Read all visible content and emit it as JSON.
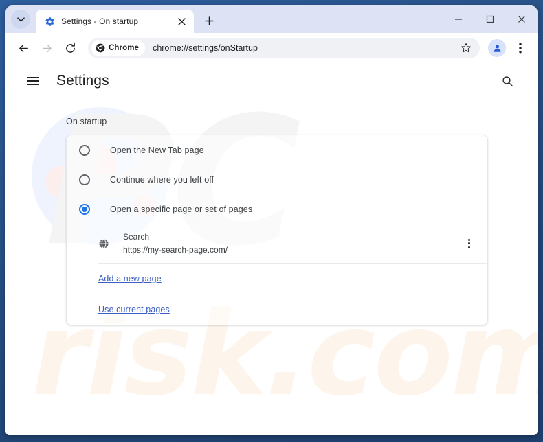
{
  "browser": {
    "tab": {
      "title": "Settings - On startup",
      "favicon": "gear-icon",
      "close": "✕"
    },
    "new_tab_label": "+",
    "window_controls": {
      "minimize": "─",
      "maximize": "□",
      "close": "✕"
    },
    "toolbar": {
      "back": "←",
      "forward": "→",
      "reload": "⟳",
      "chrome_chip_label": "Chrome",
      "url": "chrome://settings/onStartup",
      "bookmark": "☆",
      "profile": "profile-avatar",
      "menu": "⋮"
    }
  },
  "settings": {
    "title": "Settings",
    "menu_icon": "hamburger-icon",
    "search_icon": "search-icon",
    "section_title": "On startup",
    "options": [
      {
        "label": "Open the New Tab page",
        "checked": false
      },
      {
        "label": "Continue where you left off",
        "checked": false
      },
      {
        "label": "Open a specific page or set of pages",
        "checked": true
      }
    ],
    "startup_pages": [
      {
        "name": "Search",
        "url": "https://my-search-page.com/",
        "icon": "globe-icon",
        "menu": "kebab-menu-icon"
      }
    ],
    "links": {
      "add_page": "Add a new page",
      "use_current": "Use current pages"
    }
  },
  "watermark": {
    "primary": "PC",
    "secondary": "risk.com"
  },
  "colors": {
    "accent": "#1a73e8",
    "link": "#3b5fc4",
    "frame": "#2c5690",
    "tabstrip": "#dde3f5",
    "omnibox": "#eff1f5"
  }
}
